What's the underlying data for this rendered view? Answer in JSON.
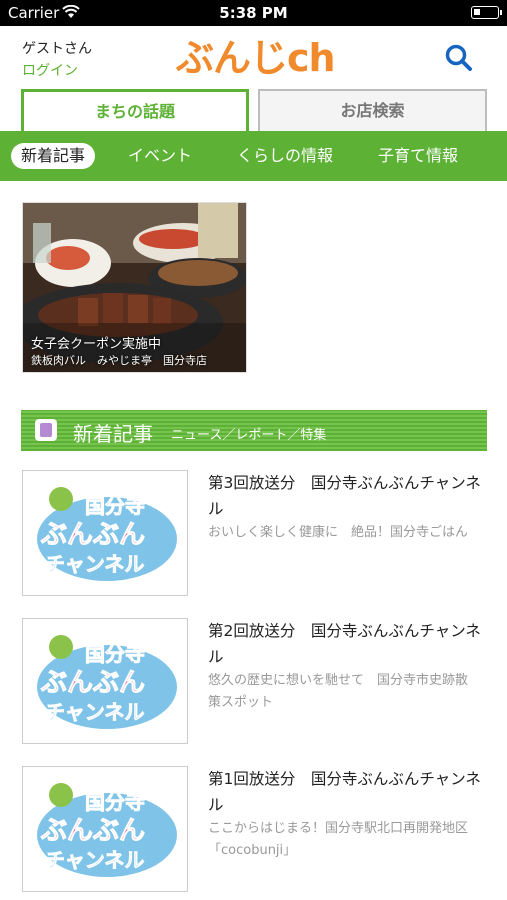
{
  "status": {
    "carrier": "Carrier",
    "time": "5:38 PM"
  },
  "header": {
    "guest": "ゲストさん",
    "login": "ログイン",
    "logo": "ぶんじch"
  },
  "tabs": [
    "まちの話題",
    "お店検索"
  ],
  "categories": [
    "新着記事",
    "イベント",
    "くらしの情報",
    "子育て情報"
  ],
  "banner": {
    "title": "女子会クーポン実施中",
    "subtitle": "鉄板肉バル　みやじま亭　国分寺店"
  },
  "section": {
    "title": "新着記事",
    "subtitle": "ニュース／レポート／特集"
  },
  "thumb": {
    "line1": "国分寺",
    "line2": "ぶんぶん",
    "line3": "チャンネル"
  },
  "articles": [
    {
      "title": "第3回放送分　国分寺ぶんぶんチャンネル",
      "desc": "おいしく楽しく健康に　絶品！国分寺ごはん"
    },
    {
      "title": "第2回放送分　国分寺ぶんぶんチャンネル",
      "desc": "悠久の歴史に想いを馳せて　国分寺市史跡散策スポット"
    },
    {
      "title": "第1回放送分　国分寺ぶんぶんチャンネル",
      "desc": "ここからはじまる！国分寺駅北口再開発地区「cocobunji」"
    }
  ]
}
